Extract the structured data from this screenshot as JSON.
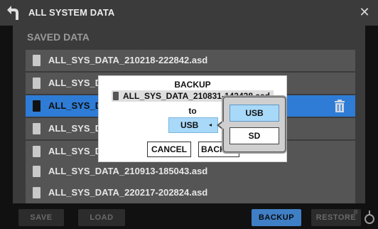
{
  "header": {
    "title": "ALL SYSTEM DATA",
    "back_icon": "back-arrow-icon",
    "close_icon": "close-icon"
  },
  "section_title": "SAVED DATA",
  "files": [
    {
      "name": "ALL_SYS_DATA_210218-222842.asd",
      "selected": false
    },
    {
      "name": "ALL_SYS_DA",
      "selected": false
    },
    {
      "name": "ALL_SYS_DA",
      "selected": true
    },
    {
      "name": "ALL_SYS_DA",
      "selected": false
    },
    {
      "name": "ALL_SYS_DA",
      "selected": false
    },
    {
      "name": "ALL_SYS_DATA_210913-185043.asd",
      "selected": false
    },
    {
      "name": "ALL_SYS_DATA_220217-202824.asd",
      "selected": false
    }
  ],
  "bottom": {
    "save": "SAVE",
    "load": "LOAD",
    "backup": "BACKUP",
    "restore": "RESTORE"
  },
  "dialog": {
    "title": "BACKUP",
    "file": "ALL_SYS_DATA_210831-142438.asd",
    "to_label": "to",
    "destination": "USB",
    "cancel": "CANCEL",
    "confirm": "BACKU"
  },
  "dropdown": {
    "options": [
      "USB",
      "SD"
    ],
    "selected": "USB"
  },
  "colors": {
    "accent": "#2e7cd6",
    "row": "#555555",
    "panel": "#3b3b3b",
    "highlight": "#a9d9f8"
  }
}
